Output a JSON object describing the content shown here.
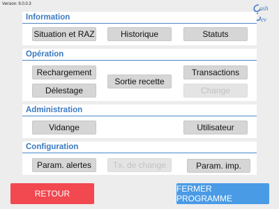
{
  "version": "Version: 9.0.0.3",
  "logo": {
    "text_top": "ash",
    "text_bottom": "ev",
    "color": "#3b79c2"
  },
  "sections": {
    "information": {
      "title": "Information",
      "buttons": {
        "situation": "Situation et RAZ",
        "historique": "Historique",
        "statuts": "Statuts"
      }
    },
    "operation": {
      "title": "Opération",
      "buttons": {
        "rechargement": "Rechargement",
        "delestage": "Délestage",
        "sortie_recette": "Sortie recette",
        "transactions": "Transactions",
        "change": "Change"
      },
      "disabled": [
        "change"
      ]
    },
    "administration": {
      "title": "Administration",
      "buttons": {
        "vidange": "Vidange",
        "utilisateur": "Utilisateur"
      }
    },
    "configuration": {
      "title": "Configuration",
      "buttons": {
        "param_alertes": "Param. alertes",
        "tx_change": "Tx. de change",
        "param_imp": "Param. imp."
      },
      "disabled": [
        "tx_change"
      ]
    }
  },
  "footer": {
    "retour": "RETOUR",
    "fermer": "FERMER PROGRAMME"
  },
  "colors": {
    "accent": "#3b79c2",
    "retour": "#f2484f",
    "fermer": "#4a9be6",
    "button": "#d6d6d6",
    "disabled_text": "#c2c2c2"
  }
}
